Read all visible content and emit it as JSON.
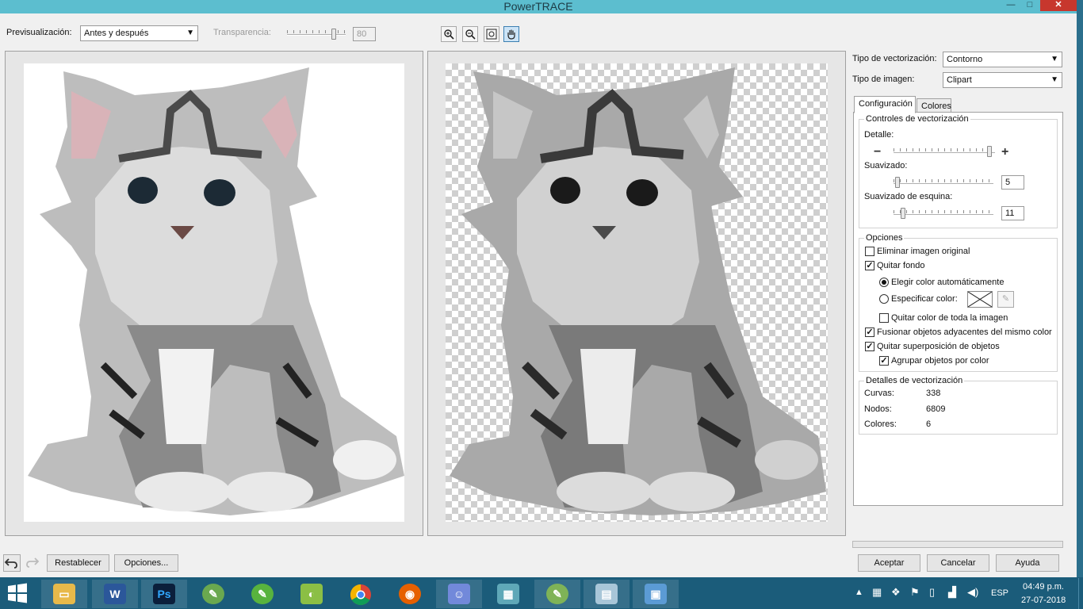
{
  "window": {
    "title": "PowerTRACE",
    "minimize": "—",
    "maximize": "□",
    "close": "✕"
  },
  "toolbar": {
    "preview_label": "Previsualización:",
    "preview_value": "Antes y después",
    "transparency_label": "Transparencia:",
    "transparency_value": "80",
    "zoom_in": "zoom-in-icon",
    "zoom_out": "zoom-out-icon",
    "fit": "fit-icon",
    "pan": "hand-icon"
  },
  "right": {
    "trace_type_label": "Tipo de vectorización:",
    "trace_type_value": "Contorno",
    "image_type_label": "Tipo de imagen:",
    "image_type_value": "Clipart",
    "tabs": [
      "Configuración",
      "Colores"
    ],
    "controls_title": "Controles de vectorización",
    "detail_label": "Detalle:",
    "minus": "−",
    "plus": "+",
    "smoothing_label": "Suavizado:",
    "smoothing_value": "5",
    "corner_label": "Suavizado de esquina:",
    "corner_value": "11",
    "options_title": "Opciones",
    "options": {
      "delete_original": "Eliminar imagen original",
      "remove_bg": "Quitar fondo",
      "auto_color": "Elegir color automáticamente",
      "specify_color": "Especificar color:",
      "remove_all_color": "Quitar color de toda la imagen",
      "merge_adjacent": "Fusionar objetos adyacentes del mismo color",
      "remove_overlap": "Quitar superposición de objetos",
      "group_by_color": "Agrupar objetos por color"
    },
    "details_title": "Detalles de vectorización",
    "details": [
      {
        "label": "Curvas:",
        "value": "338"
      },
      {
        "label": "Nodos:",
        "value": "6809"
      },
      {
        "label": "Colores:",
        "value": "6"
      }
    ]
  },
  "bottom": {
    "reset": "Restablecer",
    "options": "Opciones...",
    "accept": "Aceptar",
    "cancel": "Cancelar",
    "help": "Ayuda",
    "undo_icon": "undo-icon",
    "redo_icon": "redo-icon"
  },
  "taskbar": {
    "apps": [
      "file-explorer",
      "word",
      "photoshop",
      "coreldraw",
      "corel-app",
      "paint-app",
      "chrome",
      "firefox",
      "discord",
      "app-blocks",
      "coreldraw-2",
      "notes-app",
      "photos-app"
    ],
    "language": "ESP",
    "time": "04:49 p.m.",
    "date": "27-07-2018"
  },
  "colors": {
    "title_bar": "#5cbecf",
    "taskbar": "#1b5c7a",
    "close": "#c7372d"
  }
}
